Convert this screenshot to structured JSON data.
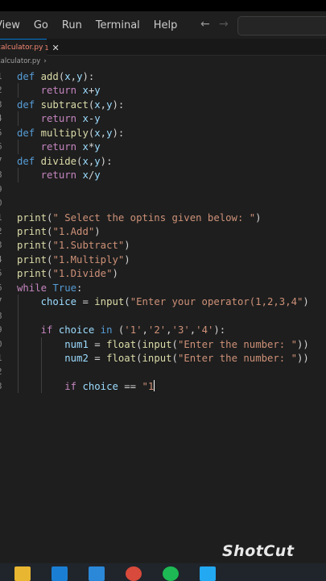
{
  "menubar": {
    "items": [
      "View",
      "Go",
      "Run",
      "Terminal",
      "Help"
    ]
  },
  "nav": {
    "back": "←",
    "forward": "→"
  },
  "tab": {
    "filename": "calculator.py",
    "badge": "1",
    "close": "✕"
  },
  "breadcrumb": {
    "file": "calculator.py",
    "chevron": "›"
  },
  "editor": {
    "lines": [
      {
        "n": "1",
        "tokens": [
          [
            "kw",
            "def "
          ],
          [
            "fn",
            "add"
          ],
          [
            "plain",
            "("
          ],
          [
            "var",
            "x"
          ],
          [
            "plain",
            ","
          ],
          [
            "var",
            "y"
          ],
          [
            "plain",
            "):"
          ]
        ]
      },
      {
        "n": "2",
        "tokens": [
          [
            "plain",
            "    "
          ],
          [
            "ctrl",
            "return "
          ],
          [
            "var",
            "x"
          ],
          [
            "plain",
            "+"
          ],
          [
            "var",
            "y"
          ]
        ]
      },
      {
        "n": "3",
        "tokens": [
          [
            "kw",
            "def "
          ],
          [
            "fn",
            "subtract"
          ],
          [
            "plain",
            "("
          ],
          [
            "var",
            "x"
          ],
          [
            "plain",
            ","
          ],
          [
            "var",
            "y"
          ],
          [
            "plain",
            "):"
          ]
        ]
      },
      {
        "n": "4",
        "tokens": [
          [
            "plain",
            "    "
          ],
          [
            "ctrl",
            "return "
          ],
          [
            "var",
            "x"
          ],
          [
            "plain",
            "-"
          ],
          [
            "var",
            "y"
          ]
        ]
      },
      {
        "n": "5",
        "tokens": [
          [
            "kw",
            "def "
          ],
          [
            "fn",
            "multiply"
          ],
          [
            "plain",
            "("
          ],
          [
            "var",
            "x"
          ],
          [
            "plain",
            ","
          ],
          [
            "var",
            "y"
          ],
          [
            "plain",
            "):"
          ]
        ]
      },
      {
        "n": "6",
        "tokens": [
          [
            "plain",
            "    "
          ],
          [
            "ctrl",
            "return "
          ],
          [
            "var",
            "x"
          ],
          [
            "plain",
            "*"
          ],
          [
            "var",
            "y"
          ]
        ]
      },
      {
        "n": "7",
        "tokens": [
          [
            "kw",
            "def "
          ],
          [
            "fn",
            "divide"
          ],
          [
            "plain",
            "("
          ],
          [
            "var",
            "x"
          ],
          [
            "plain",
            ","
          ],
          [
            "var",
            "y"
          ],
          [
            "plain",
            "):"
          ]
        ]
      },
      {
        "n": "8",
        "tokens": [
          [
            "plain",
            "    "
          ],
          [
            "ctrl",
            "return "
          ],
          [
            "var",
            "x"
          ],
          [
            "plain",
            "/"
          ],
          [
            "var",
            "y"
          ]
        ]
      },
      {
        "n": "9",
        "tokens": []
      },
      {
        "n": "0",
        "tokens": []
      },
      {
        "n": "1",
        "tokens": [
          [
            "fn",
            "print"
          ],
          [
            "plain",
            "("
          ],
          [
            "str",
            "\" Select the optins given below: \""
          ],
          [
            "plain",
            ")"
          ]
        ]
      },
      {
        "n": "2",
        "tokens": [
          [
            "fn",
            "print"
          ],
          [
            "plain",
            "("
          ],
          [
            "str",
            "\"1.Add\""
          ],
          [
            "plain",
            ")"
          ]
        ]
      },
      {
        "n": "3",
        "tokens": [
          [
            "fn",
            "print"
          ],
          [
            "plain",
            "("
          ],
          [
            "str",
            "\"1.Subtract\""
          ],
          [
            "plain",
            ")"
          ]
        ]
      },
      {
        "n": "4",
        "tokens": [
          [
            "fn",
            "print"
          ],
          [
            "plain",
            "("
          ],
          [
            "str",
            "\"1.Multiply\""
          ],
          [
            "plain",
            ")"
          ]
        ]
      },
      {
        "n": "5",
        "tokens": [
          [
            "fn",
            "print"
          ],
          [
            "plain",
            "("
          ],
          [
            "str",
            "\"1.Divide\""
          ],
          [
            "plain",
            ")"
          ]
        ]
      },
      {
        "n": "6",
        "tokens": [
          [
            "ctrl",
            "while "
          ],
          [
            "true-kw",
            "True"
          ],
          [
            "plain",
            ":"
          ]
        ]
      },
      {
        "n": "7",
        "tokens": [
          [
            "plain",
            "    "
          ],
          [
            "var",
            "choice"
          ],
          [
            "plain",
            " = "
          ],
          [
            "fn",
            "input"
          ],
          [
            "plain",
            "("
          ],
          [
            "str",
            "\"Enter your operator(1,2,3,4\""
          ],
          [
            "plain",
            ")"
          ]
        ]
      },
      {
        "n": "8",
        "tokens": []
      },
      {
        "n": "9",
        "tokens": [
          [
            "plain",
            "    "
          ],
          [
            "ctrl",
            "if "
          ],
          [
            "var",
            "choice"
          ],
          [
            "plain",
            " "
          ],
          [
            "kw",
            "in"
          ],
          [
            "plain",
            " ("
          ],
          [
            "str",
            "'1'"
          ],
          [
            "plain",
            ","
          ],
          [
            "str",
            "'2'"
          ],
          [
            "plain",
            ","
          ],
          [
            "str",
            "'3'"
          ],
          [
            "plain",
            ","
          ],
          [
            "str",
            "'4'"
          ],
          [
            "plain",
            "):"
          ]
        ]
      },
      {
        "n": "0",
        "tokens": [
          [
            "plain",
            "        "
          ],
          [
            "var",
            "num1"
          ],
          [
            "plain",
            " = "
          ],
          [
            "fn",
            "float"
          ],
          [
            "plain",
            "("
          ],
          [
            "fn",
            "input"
          ],
          [
            "plain",
            "("
          ],
          [
            "str",
            "\"Enter the number: \""
          ],
          [
            "plain",
            "))"
          ]
        ]
      },
      {
        "n": "1",
        "tokens": [
          [
            "plain",
            "        "
          ],
          [
            "var",
            "num2"
          ],
          [
            "plain",
            " = "
          ],
          [
            "fn",
            "float"
          ],
          [
            "plain",
            "("
          ],
          [
            "fn",
            "input"
          ],
          [
            "plain",
            "("
          ],
          [
            "str",
            "\"Enter the number: \""
          ],
          [
            "plain",
            "))"
          ]
        ]
      },
      {
        "n": "2",
        "tokens": []
      },
      {
        "n": "3",
        "tokens": [
          [
            "plain",
            "        "
          ],
          [
            "ctrl",
            "if "
          ],
          [
            "var",
            "choice"
          ],
          [
            "plain",
            " == "
          ],
          [
            "str",
            "\"1"
          ]
        ],
        "cursor": true
      }
    ]
  },
  "watermark": "ShotCut",
  "colors": {
    "background": "#1e1e1e",
    "keyword": "#569cd6",
    "control": "#c586c0",
    "function": "#dcdcaa",
    "variable": "#9cdcfe",
    "string": "#ce9178",
    "tab_modified": "#f48771"
  },
  "taskbar": {
    "icons": [
      {
        "name": "file-explorer-icon",
        "color": "#e8b631"
      },
      {
        "name": "mail-icon",
        "color": "#1a7fd4"
      },
      {
        "name": "store-icon",
        "color": "#2b88d8"
      },
      {
        "name": "media-player-icon",
        "color": "#d84a3b"
      },
      {
        "name": "spotify-icon",
        "color": "#1db954"
      },
      {
        "name": "vscode-icon",
        "color": "#23a9f2"
      }
    ]
  }
}
